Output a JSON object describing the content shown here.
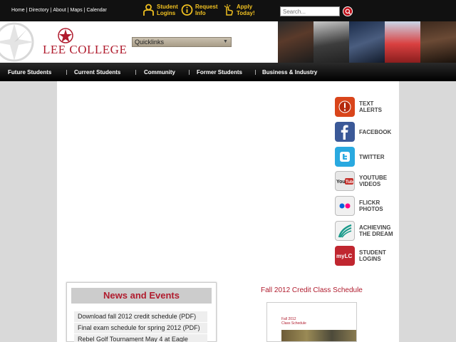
{
  "top_links": [
    "Home",
    "Directory",
    "About",
    "Maps",
    "Calendar"
  ],
  "quick_icons": [
    {
      "label": "Student\nLogins",
      "icon": "student-logins-icon"
    },
    {
      "label": "Request\nInfo",
      "icon": "info-icon"
    },
    {
      "label": "Apply\nToday!",
      "icon": "apply-hand-icon"
    }
  ],
  "search": {
    "placeholder": "Search..."
  },
  "logo": {
    "word1": "Lee",
    "word2": "College"
  },
  "quicklinks": {
    "label": "Quicklinks"
  },
  "nav": [
    "Future Students",
    "Current Students",
    "Community",
    "Former Students",
    "Business & Industry"
  ],
  "social": [
    {
      "label": "TEXT\nALERTS",
      "icon": "alert-icon",
      "color": "#d9451b"
    },
    {
      "label": "FACEBOOK",
      "icon": "facebook-icon",
      "color": "#3b5998"
    },
    {
      "label": "TWITTER",
      "icon": "twitter-icon",
      "color": "#29a9e0"
    },
    {
      "label": "YOUTUBE\nVIDEOS",
      "icon": "youtube-icon",
      "color": "#e7e7e7"
    },
    {
      "label": "FLICKR\nPHOTOS",
      "icon": "flickr-icon",
      "color": "#f0f0f0"
    },
    {
      "label": "ACHIEVING\nTHE DREAM",
      "icon": "achieving-dream-icon",
      "color": "#f2f2f2"
    },
    {
      "label": "STUDENT\nLOGINS",
      "icon": "mylc-icon",
      "color": "#c0262f"
    }
  ],
  "news": {
    "title": "News and Events",
    "items": [
      "Download fall 2012 credit schedule (PDF)",
      "Final exam schedule for spring 2012 (PDF)",
      "Rebel Golf Tournament May 4 at Eagle"
    ]
  },
  "schedule": {
    "title": "Fall 2012 Credit Class Schedule",
    "cover_text": "Fall 2012\nClass Schedule"
  },
  "colors": {
    "brand_red": "#b01c2e",
    "accent_gold": "#f0c020"
  }
}
